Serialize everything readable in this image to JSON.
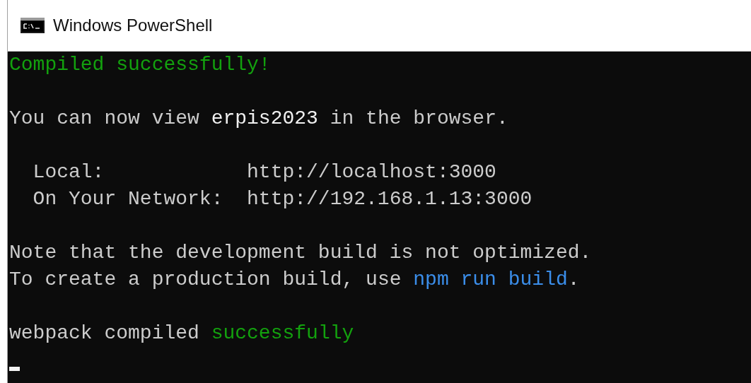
{
  "window": {
    "title": "Windows PowerShell"
  },
  "lines": [
    {
      "kind": "text",
      "segments": [
        {
          "text": "Compiled successfully!",
          "kind": "green"
        }
      ]
    },
    {
      "kind": "blank"
    },
    {
      "kind": "text",
      "segments": [
        {
          "text": "You can now view ",
          "kind": "plain"
        },
        {
          "text": "erpis2023",
          "kind": "bright"
        },
        {
          "text": " in the browser.",
          "kind": "plain"
        }
      ]
    },
    {
      "kind": "blank"
    },
    {
      "kind": "field",
      "label": "Local:",
      "value": "http://localhost:3000"
    },
    {
      "kind": "field",
      "label": "On Your Network:",
      "value": "http://192.168.1.13:3000"
    },
    {
      "kind": "blank"
    },
    {
      "kind": "text",
      "segments": [
        {
          "text": "Note that the development build is not optimized.",
          "kind": "plain"
        }
      ]
    },
    {
      "kind": "text",
      "segments": [
        {
          "text": "To create a production build, use ",
          "kind": "plain"
        },
        {
          "text": "npm run build",
          "kind": "blue"
        },
        {
          "text": ".",
          "kind": "plain"
        }
      ]
    },
    {
      "kind": "blank"
    },
    {
      "kind": "text",
      "segments": [
        {
          "text": "webpack compiled ",
          "kind": "plain"
        },
        {
          "text": "successfully",
          "kind": "green"
        }
      ]
    },
    {
      "kind": "cursor"
    }
  ]
}
